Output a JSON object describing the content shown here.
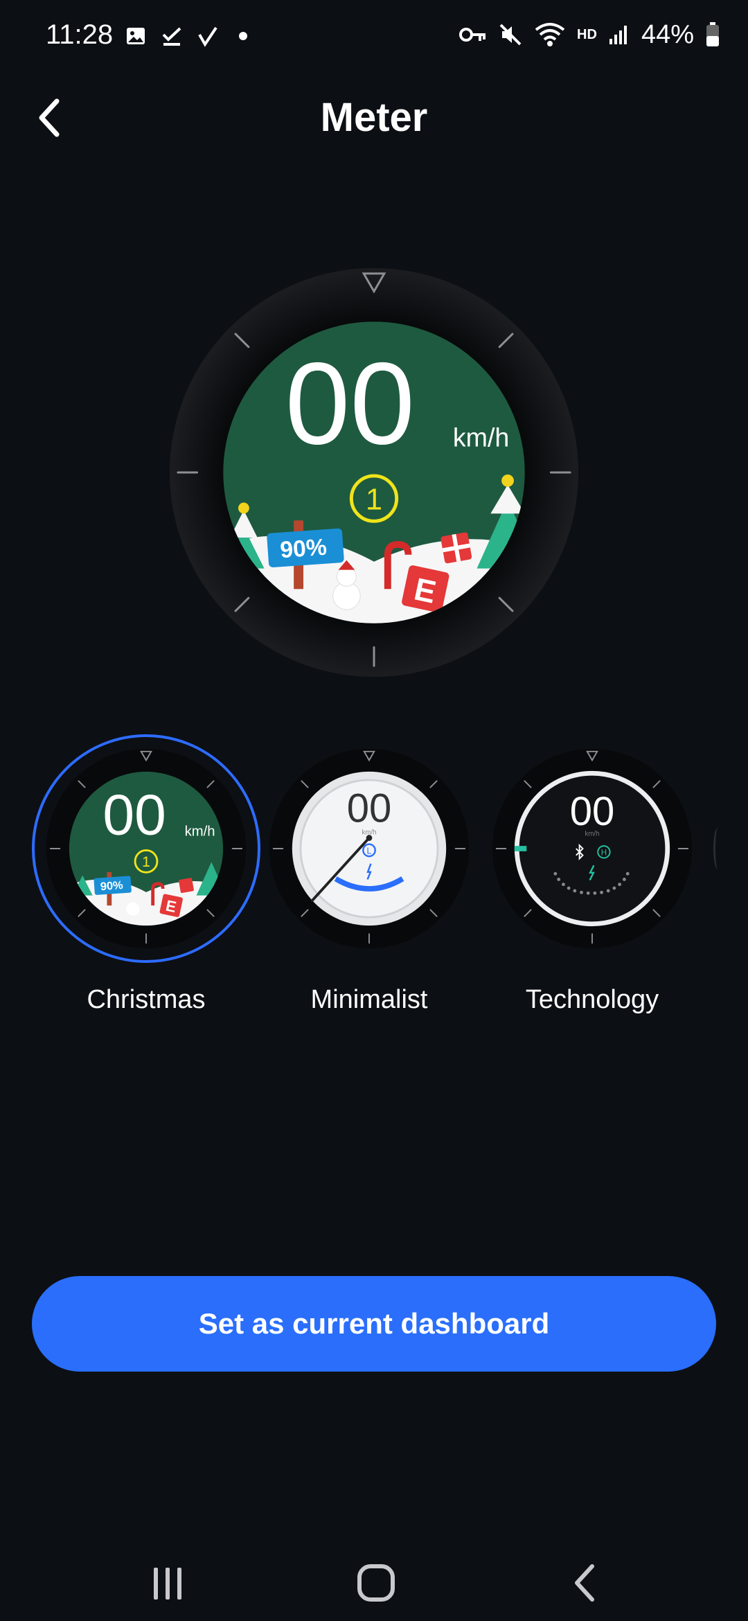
{
  "status_bar": {
    "time": "11:28",
    "battery": "44%",
    "network_label": "HD",
    "left_icons": [
      "gallery-icon",
      "checkmark-icon",
      "location-arrow-icon",
      "dot-icon"
    ],
    "right_icons": [
      "vpn-key-icon",
      "mute-icon",
      "wifi-icon",
      "signal-icon",
      "battery-icon"
    ]
  },
  "header": {
    "title": "Meter"
  },
  "preview": {
    "speed": "00",
    "unit": "km/h",
    "gear": "1",
    "battery": "90%",
    "mode": "E"
  },
  "themes": [
    {
      "label": "Christmas",
      "speed": "00",
      "unit": "km/h",
      "gear": "1",
      "battery": "90%",
      "mode": "E",
      "selected": true
    },
    {
      "label": "Minimalist",
      "speed": "00",
      "unit": "km/h",
      "gear": "L",
      "selected": false
    },
    {
      "label": "Technology",
      "speed": "00",
      "unit": "km/h",
      "gear": "H",
      "selected": false
    }
  ],
  "cta": {
    "label": "Set as current dashboard"
  },
  "colors": {
    "accent": "#2a6efb",
    "background": "#0c0f14",
    "christmas_green": "#1e5a40",
    "gear_yellow": "#f0e41a",
    "tech_teal": "#25c0a0"
  }
}
